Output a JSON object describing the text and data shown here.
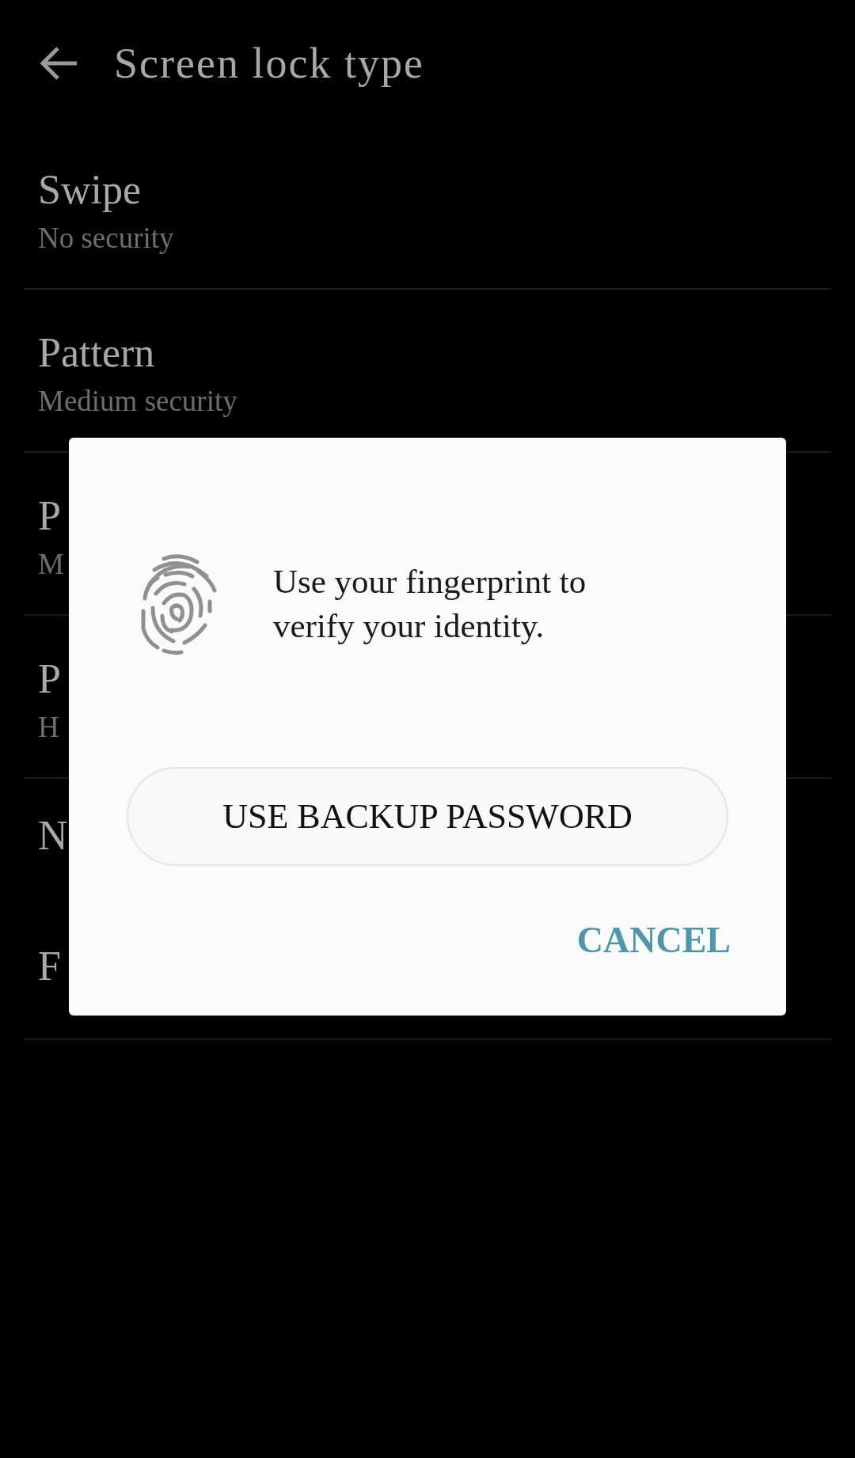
{
  "header": {
    "title": "Screen lock type"
  },
  "options": [
    {
      "title": "Swipe",
      "subtitle": "No security"
    },
    {
      "title": "Pattern",
      "subtitle": "Medium security"
    },
    {
      "title": "P",
      "subtitle": "M"
    },
    {
      "title": "P",
      "subtitle": "H"
    },
    {
      "title": "N"
    },
    {
      "title": "F"
    }
  ],
  "dialog": {
    "message": "Use your fingerprint to verify your identity.",
    "backup_button": "USE BACKUP PASSWORD",
    "cancel_button": "CANCEL"
  }
}
